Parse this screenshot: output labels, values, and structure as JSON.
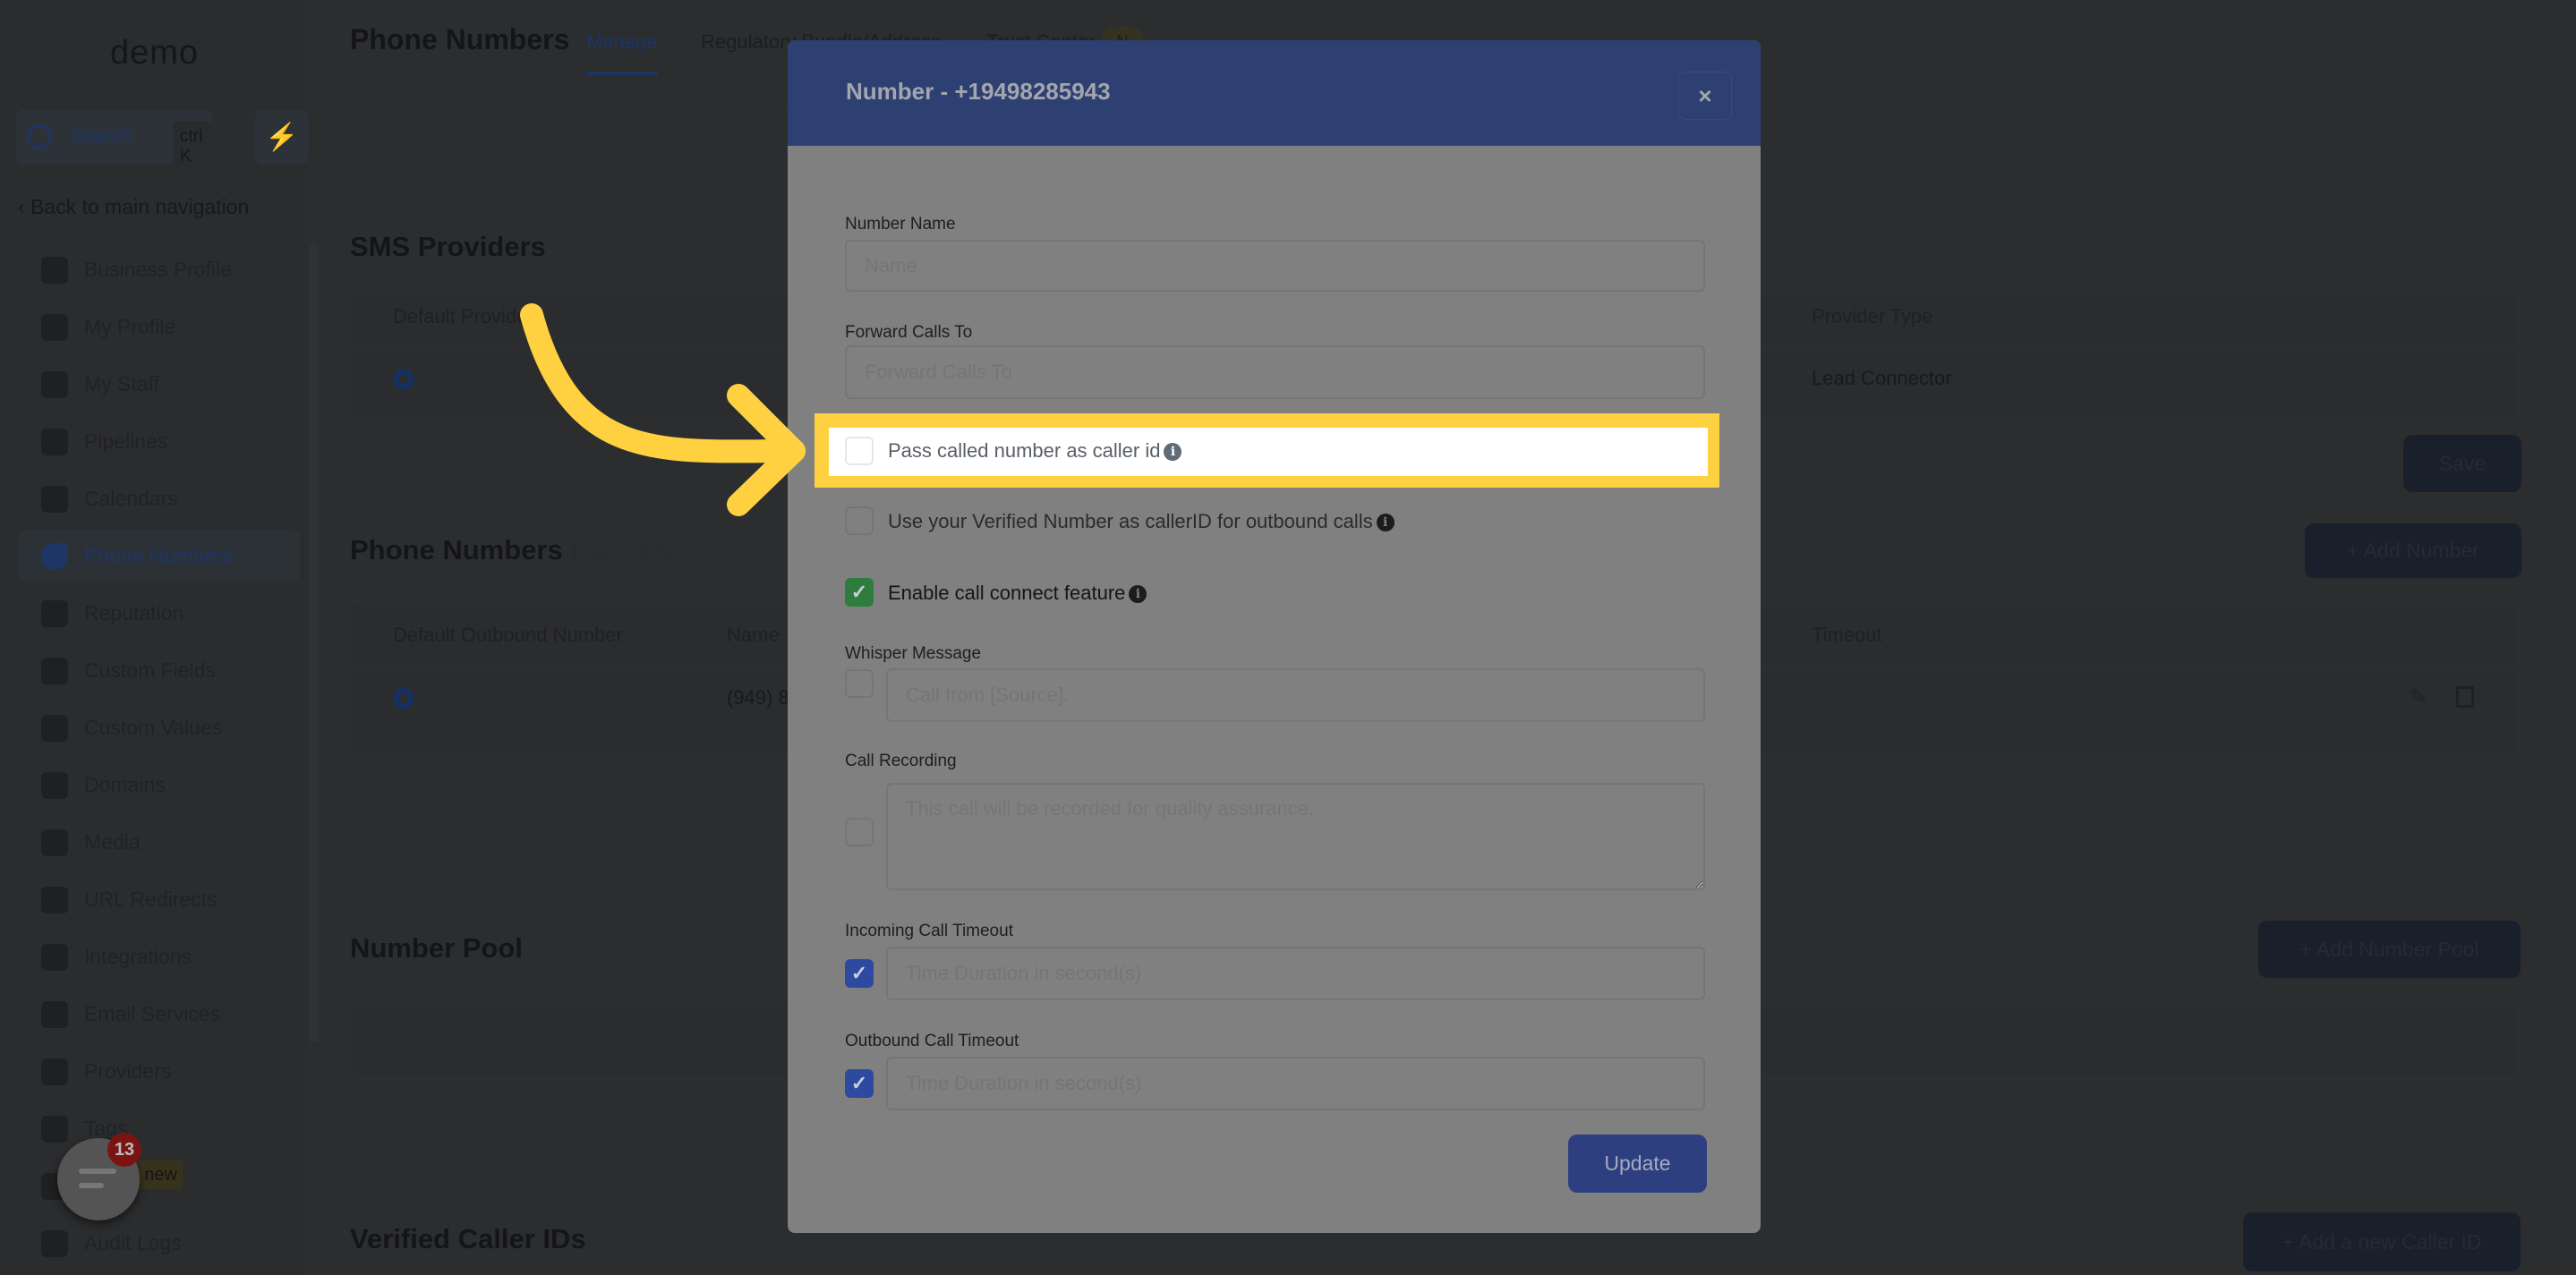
{
  "sidebar": {
    "logo": "demo",
    "search_label": "Search",
    "search_shortcut": "ctrl K",
    "back_label": "Back to main navigation",
    "items": [
      {
        "label": "Business Profile",
        "icon": "briefcase-icon"
      },
      {
        "label": "My Profile",
        "icon": "user-circle-icon"
      },
      {
        "label": "My Staff",
        "icon": "user-icon"
      },
      {
        "label": "Pipelines",
        "icon": "funnel-icon"
      },
      {
        "label": "Calendars",
        "icon": "calendar-icon"
      },
      {
        "label": "Phone Numbers",
        "icon": "phone-icon",
        "active": true
      },
      {
        "label": "Reputation",
        "icon": "star-icon"
      },
      {
        "label": "Custom Fields",
        "icon": "text-field-icon"
      },
      {
        "label": "Custom Values",
        "icon": "diamond-icon"
      },
      {
        "label": "Domains",
        "icon": "globe-icon"
      },
      {
        "label": "Media",
        "icon": "media-icon"
      },
      {
        "label": "URL Redirects",
        "icon": "redirect-icon"
      },
      {
        "label": "Integrations",
        "icon": "integrations-icon"
      },
      {
        "label": "Email Services",
        "icon": "email-icon"
      },
      {
        "label": "Providers",
        "icon": "clipboard-check-icon"
      },
      {
        "label": "Tags",
        "icon": "tag-icon"
      },
      {
        "label": "",
        "icon": "flask-icon"
      },
      {
        "label": "Audit Logs",
        "icon": "bar-chart-icon"
      }
    ],
    "new_badge": "new"
  },
  "header": {
    "title": "Phone Numbers",
    "tabs": [
      {
        "label": "Manage",
        "active": true
      },
      {
        "label": "Regulatory Bundle/Address"
      },
      {
        "label": "Trust Center"
      }
    ],
    "trust_badge": "N"
  },
  "sms_providers": {
    "title": "SMS Providers",
    "columns": [
      "Default Provider",
      "Provider Type"
    ],
    "row": {
      "provider_type": "Lead Connector"
    },
    "save_label": "Save"
  },
  "phone_numbers": {
    "title": "Phone Numbers",
    "count": "1 accounts",
    "add_label": "Add Number",
    "columns": [
      "Default Outbound Number",
      "Name",
      "Timeout"
    ],
    "row": {
      "name": "(949) 8"
    }
  },
  "number_pool": {
    "title": "Number Pool",
    "add_label": "Add Number Pool"
  },
  "verified_caller_ids": {
    "title": "Verified Caller IDs",
    "add_label": "Add a new Caller ID"
  },
  "chat_widget": {
    "badge": "13"
  },
  "modal": {
    "title": "Number - +19498285943",
    "close": "×",
    "number_name": {
      "label": "Number Name",
      "placeholder": "Name"
    },
    "forward_calls": {
      "label": "Forward Calls To",
      "placeholder": "Forward Calls To"
    },
    "pass_called": {
      "label": "Pass called number as caller id",
      "checked": false
    },
    "use_verified": {
      "label": "Use your Verified Number as callerID for outbound calls",
      "checked": false
    },
    "call_connect": {
      "label": "Enable call connect feature",
      "checked": true
    },
    "whisper": {
      "label": "Whisper Message",
      "placeholder": "Call from [Source].",
      "checked": false
    },
    "recording": {
      "label": "Call Recording",
      "placeholder": "This call will be recorded for quality assurance.",
      "checked": false
    },
    "incoming_timeout": {
      "label": "Incoming Call Timeout",
      "placeholder": "Time Duration in second(s)",
      "checked": true
    },
    "outbound_timeout": {
      "label": "Outbound Call Timeout",
      "placeholder": "Time Duration in second(s)",
      "checked": true
    },
    "update_label": "Update"
  },
  "colors": {
    "modal_header": "#2e3f72",
    "highlight": "#ffd140",
    "checkbox_green": "#2f7d3c",
    "checkbox_blue": "#2e4aa0"
  }
}
